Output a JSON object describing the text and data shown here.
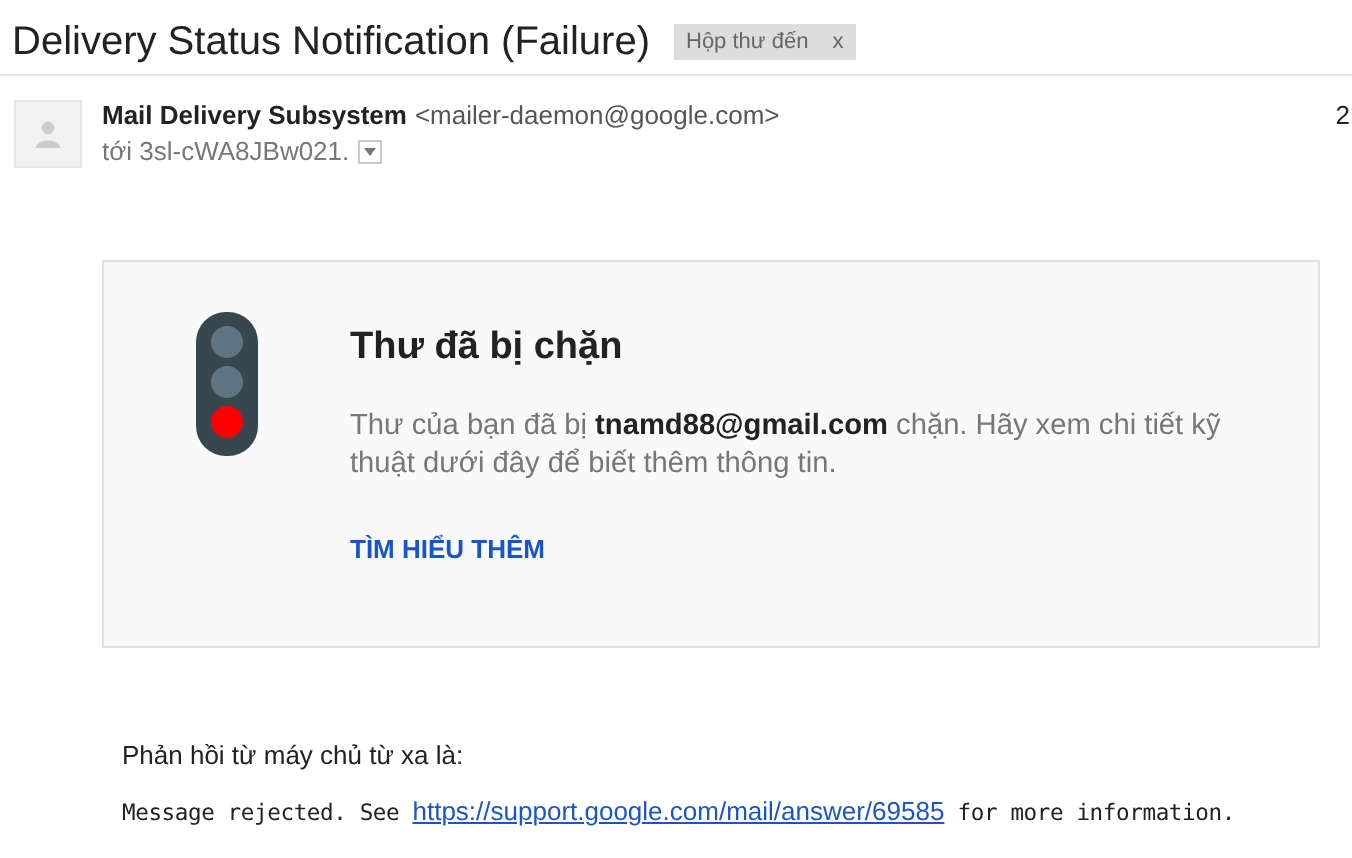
{
  "subject": "Delivery Status Notification (Failure)",
  "label": {
    "name": "Hộp thư đến",
    "remove": "x"
  },
  "sender": {
    "name": "Mail Delivery Subsystem",
    "address": "<mailer-daemon@google.com>",
    "to": "tới 3sl-cWA8JBw021.",
    "time": "2"
  },
  "card": {
    "title": "Thư đã bị chặn",
    "text": "Thư của bạn đã bị **tnamd88@gmail.com** chặn. Hãy xem chi tiết kỹ thuật dưới đây để biết thêm thông tin.",
    "link": "TÌM HIỂU THÊM"
  },
  "reply_intro": "Phản hồi từ máy chủ từ xa là:",
  "reply": {
    "before": "Message rejected. See",
    "link": "https://support.google.com/mail/answer/69585",
    "after": "for more information."
  }
}
